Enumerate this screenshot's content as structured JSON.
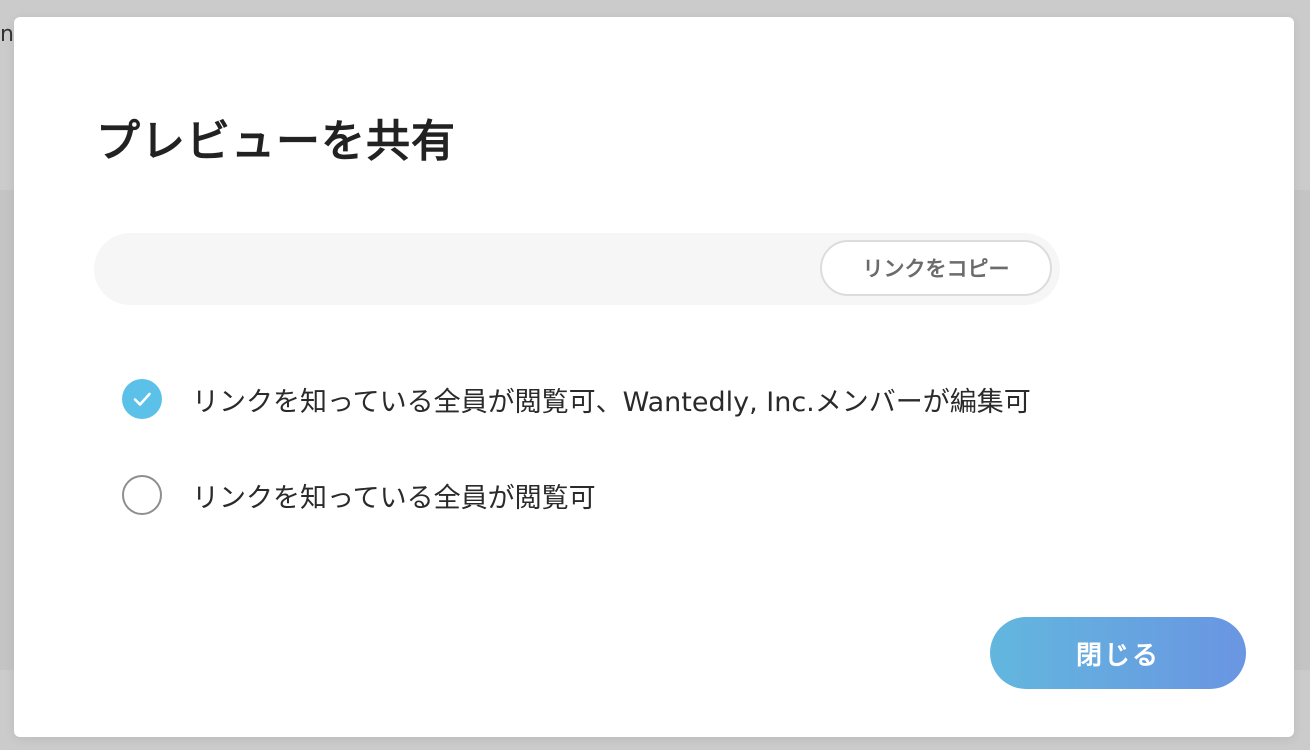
{
  "background": {
    "peek_text": "nt"
  },
  "dialog": {
    "title": "プレビューを共有",
    "link_field": {
      "value": "",
      "copy_button_label": "リンクをコピー"
    },
    "options": [
      {
        "label": "リンクを知っている全員が閲覧可、Wantedly, Inc.メンバーが編集可",
        "selected": true
      },
      {
        "label": "リンクを知っている全員が閲覧可",
        "selected": false
      }
    ],
    "close_button_label": "閉じる"
  },
  "colors": {
    "accent_check": "#5bc1e9",
    "button_gradient_start": "#62b7de",
    "button_gradient_end": "#6a95e2"
  },
  "icons": {
    "selected": "checkmark-icon",
    "unselected": "radio-empty-icon"
  }
}
